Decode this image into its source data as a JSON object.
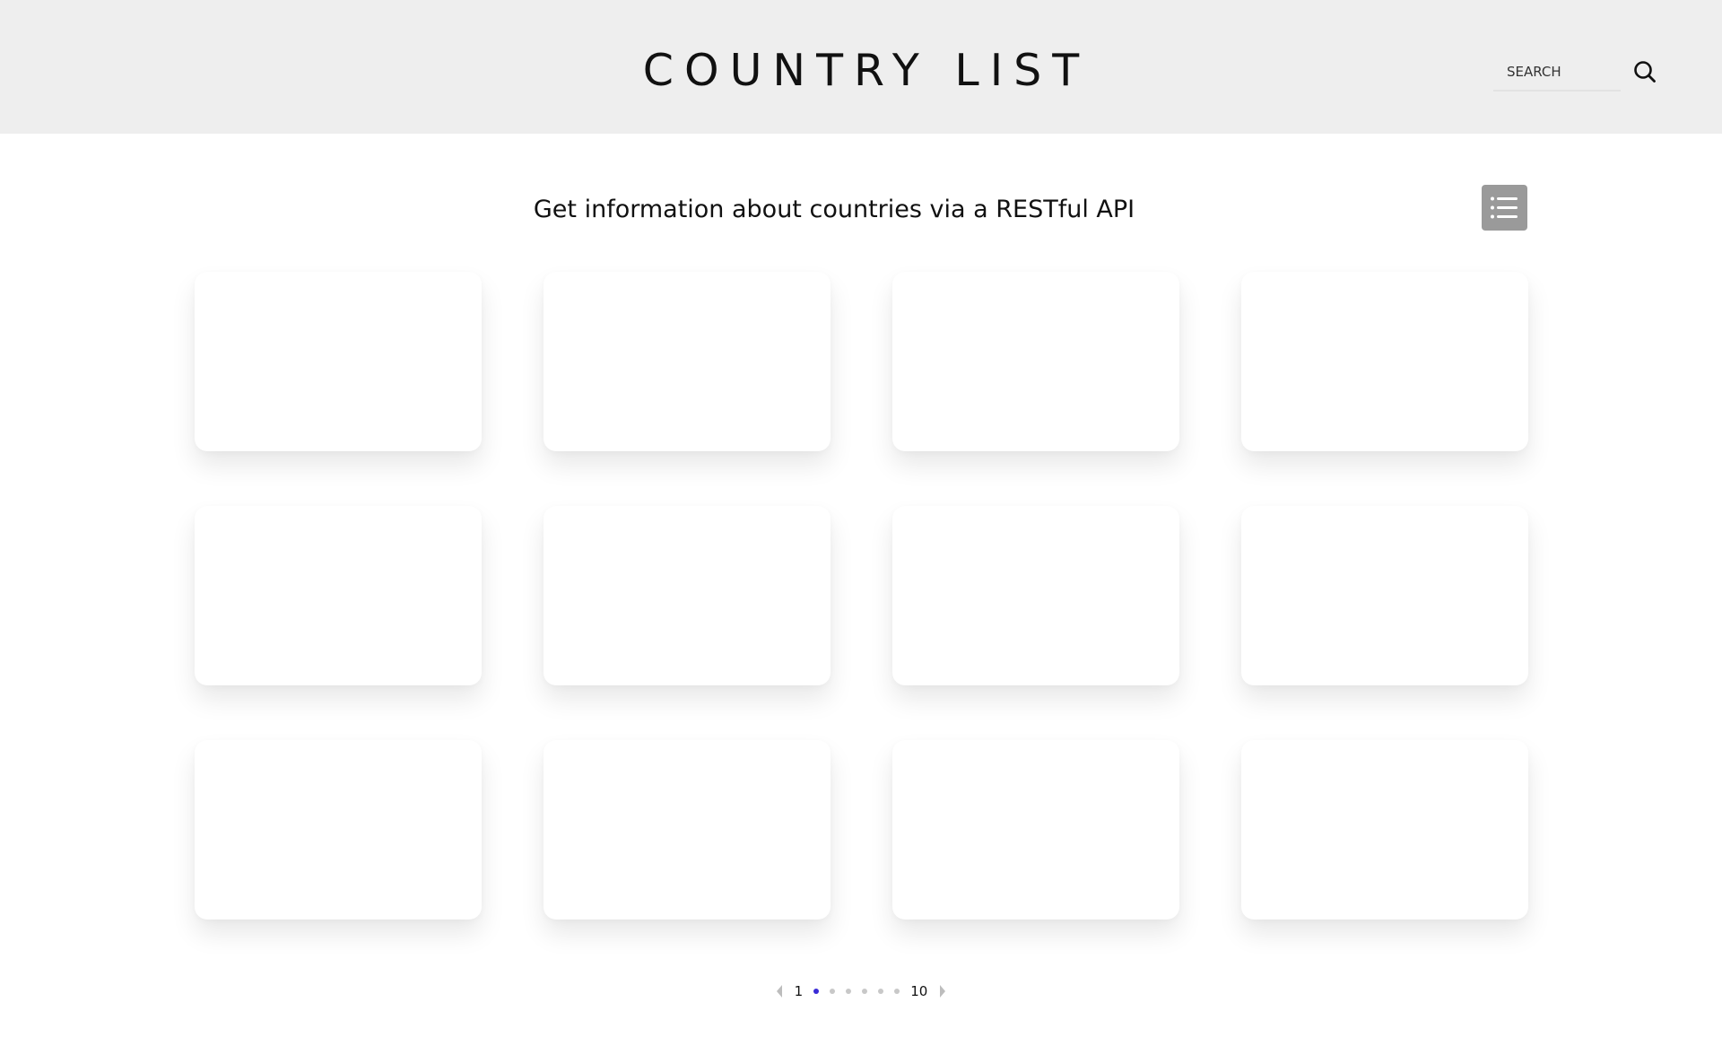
{
  "header": {
    "title": "COUNTRY LIST",
    "search": {
      "placeholder": "SEARCH",
      "value": "",
      "button_icon": "search-icon"
    },
    "background": "#eeeeee"
  },
  "main": {
    "subtitle": "Get information about countries via a RESTful API",
    "view_toggle_icon": "list-icon",
    "cards": [
      {},
      {},
      {},
      {},
      {},
      {},
      {},
      {},
      {},
      {},
      {},
      {}
    ]
  },
  "pagination": {
    "first_page": "1",
    "last_page": "10",
    "current_page": 1,
    "dot_count": 6,
    "prev_icon": "chevron-left-icon",
    "next_icon": "chevron-right-icon",
    "active_color": "#3a2bd6"
  }
}
